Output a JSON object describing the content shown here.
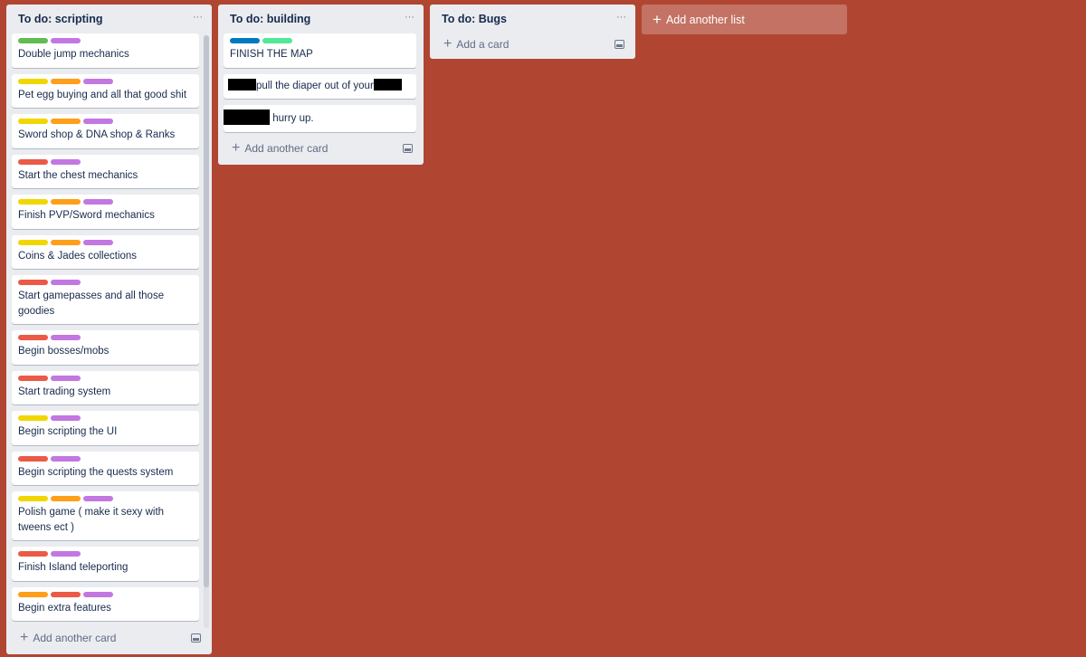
{
  "colors": {
    "board_bg": "#b04632",
    "green": "#61bd4f",
    "yellow": "#f2d600",
    "orange": "#ff9f1a",
    "red": "#eb5a46",
    "purple": "#c377e0",
    "blue": "#0079bf",
    "lime": "#51e898"
  },
  "lists": [
    {
      "title": "To do: scripting",
      "menu": "···",
      "footer": "Add another card",
      "cards": [
        {
          "labels": [
            "green",
            "purple"
          ],
          "title": "Double jump mechanics"
        },
        {
          "labels": [
            "yellow",
            "orange",
            "purple"
          ],
          "title": "Pet egg buying and all that good shit"
        },
        {
          "labels": [
            "yellow",
            "orange",
            "purple"
          ],
          "title": "Sword shop & DNA shop & Ranks"
        },
        {
          "labels": [
            "red",
            "purple"
          ],
          "title": "Start the chest mechanics"
        },
        {
          "labels": [
            "yellow",
            "orange",
            "purple"
          ],
          "title": "Finish PVP/Sword mechanics"
        },
        {
          "labels": [
            "yellow",
            "orange",
            "purple"
          ],
          "title": "Coins & Jades collections"
        },
        {
          "labels": [
            "red",
            "purple"
          ],
          "title": "Start gamepasses and all those goodies"
        },
        {
          "labels": [
            "red",
            "purple"
          ],
          "title": "Begin bosses/mobs"
        },
        {
          "labels": [
            "red",
            "purple"
          ],
          "title": "Start trading system"
        },
        {
          "labels": [
            "yellow",
            "purple"
          ],
          "title": "Begin scripting the UI"
        },
        {
          "labels": [
            "red",
            "purple"
          ],
          "title": "Begin scripting the quests system"
        },
        {
          "labels": [
            "yellow",
            "orange",
            "purple"
          ],
          "title": "Polish game ( make it sexy with tweens ect )"
        },
        {
          "labels": [
            "red",
            "purple"
          ],
          "title": "Finish Island teleporting"
        },
        {
          "labels": [
            "orange",
            "red",
            "purple"
          ],
          "title": "Begin extra features"
        },
        {
          "labels": [
            "orange",
            "purple"
          ],
          "title": ""
        }
      ]
    },
    {
      "title": "To do: building",
      "menu": "···",
      "footer": "Add another card",
      "cards": [
        {
          "labels": [
            "blue",
            "lime"
          ],
          "title": "FINISH THE MAP"
        },
        {
          "labels": [],
          "title": "pull the diaper out of your",
          "redacted": "before-after"
        },
        {
          "labels": [],
          "title": " hurry up.",
          "redacted": "before"
        }
      ]
    },
    {
      "title": "To do: Bugs",
      "menu": "···",
      "footer": "Add a card",
      "cards": []
    }
  ],
  "add_list_label": "Add another list"
}
